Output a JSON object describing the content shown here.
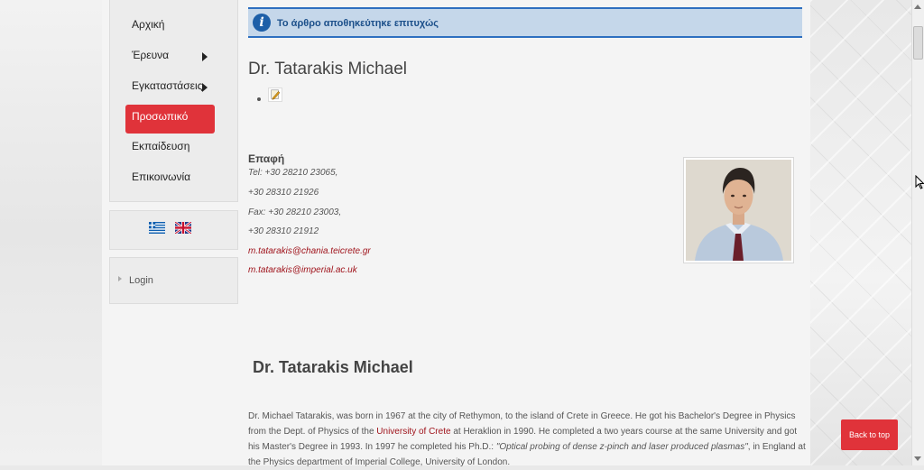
{
  "sidebar": {
    "menu": [
      {
        "label": "Αρχική",
        "has_submenu": false,
        "active": false
      },
      {
        "label": "Έρευνα",
        "has_submenu": true,
        "active": false
      },
      {
        "label": "Εγκαταστάσεις",
        "has_submenu": true,
        "active": false
      },
      {
        "label": "Προσωπικό",
        "has_submenu": false,
        "active": true
      },
      {
        "label": "Εκπαίδευση",
        "has_submenu": false,
        "active": false
      },
      {
        "label": "Επικοινωνία",
        "has_submenu": false,
        "active": false
      }
    ],
    "languages": [
      "greek-flag-icon",
      "uk-flag-icon"
    ],
    "login_label": "Login"
  },
  "notice": {
    "icon": "info-icon",
    "text": "Το άρθρο αποθηκεύτηκε επιτυχώς"
  },
  "article": {
    "title": "Dr. Tatarakis Michael",
    "edit_icon": "edit-icon",
    "contact_heading": "Επαφή",
    "contact_lines": [
      "Tel: +30 28210 23065,",
      "+30 28310 21926",
      "Fax: +30 28210 23003,",
      "+30 28310 21912"
    ],
    "emails": [
      "m.tatarakis@chania.teicrete.gr",
      "m.tatarakis@imperial.ac.uk"
    ],
    "bio_heading": "Dr. Tatarakis Michael",
    "bio": {
      "part1": "Dr. Michael Tatarakis, was born in 1967 at the city of Rethymon, to the island of Crete in Greece. He got his Bachelor's Degree in Physics from the Dept. of Physics of the ",
      "link1": "University of Crete",
      "part2": " at Heraklion in 1990. He completed a two years course at the same University and got his Master's Degree in 1993. In 1997 he completed his Ph.D.: ",
      "quote": "\"Optical probing of dense z-pinch and laser produced plasmas\"",
      "part3": ", in England at the Physics department of Imperial College, University of London."
    }
  },
  "back_to_top_label": "Back to top",
  "colors": {
    "accent_red": "#e0333a",
    "link_red": "#a0151d",
    "notice_blue": "#2e6fc0"
  }
}
